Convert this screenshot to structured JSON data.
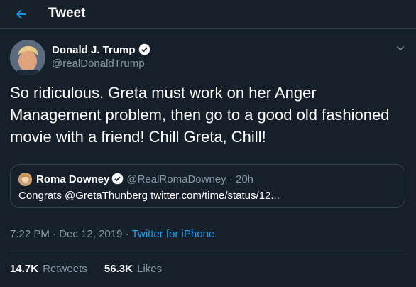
{
  "header": {
    "title": "Tweet"
  },
  "tweet": {
    "author_name": "Donald J. Trump",
    "author_handle": "@realDonaldTrump",
    "text": "So ridiculous. Greta must work on her Anger Management problem, then go to a good old fashioned movie with a friend! Chill Greta, Chill!",
    "time": "7:22 PM",
    "date": "Dec 12, 2019",
    "separator": "·",
    "source": "Twitter for iPhone"
  },
  "quote": {
    "author_name": "Roma Downey",
    "author_handle": "@RealRomaDowney",
    "separator": "·",
    "age": "20h",
    "text": "Congrats @GretaThunberg twitter.com/time/status/12..."
  },
  "stats": {
    "retweets_count": "14.7K",
    "retweets_label": "Retweets",
    "likes_count": "56.3K",
    "likes_label": "Likes"
  },
  "colors": {
    "background": "#15202b",
    "accent": "#1da1f2",
    "secondary_text": "#8899a6",
    "border": "#38444d"
  }
}
